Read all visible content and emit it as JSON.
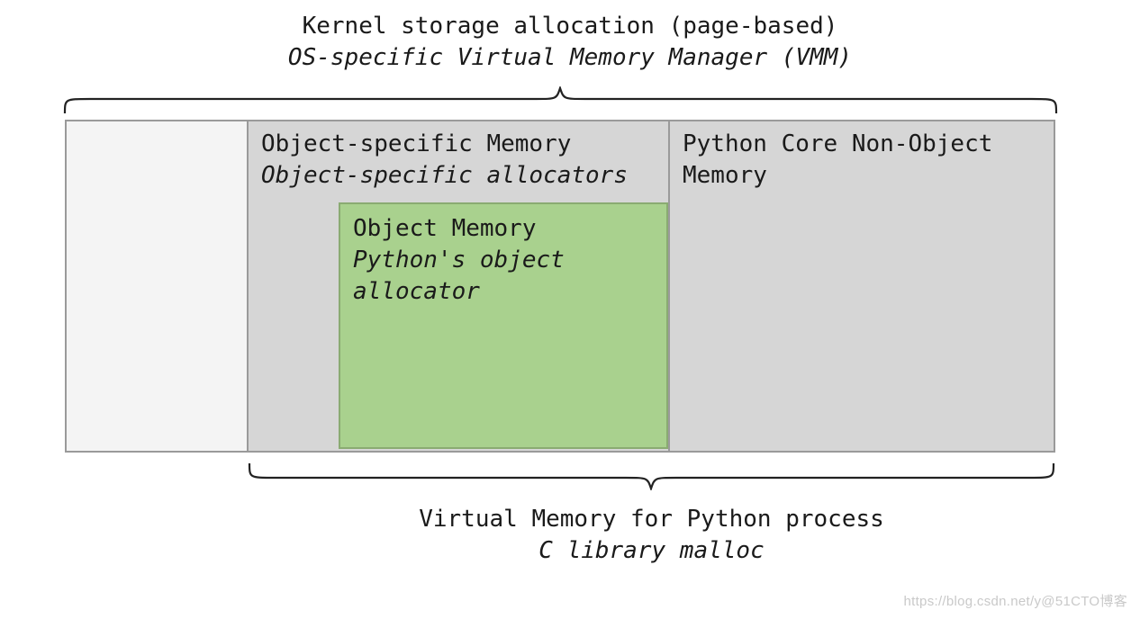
{
  "top": {
    "line1": "Kernel storage allocation (page-based)",
    "line2": "OS-specific Virtual Memory Manager (VMM)"
  },
  "mid": {
    "line1": "Object-specific Memory",
    "line2": "Object-specific allocators"
  },
  "green": {
    "line1": "Object Memory",
    "line2": "Python's object",
    "line3": "allocator"
  },
  "right": {
    "line1": "Python Core Non-Object",
    "line2": "Memory"
  },
  "bottom": {
    "line1": "Virtual Memory for Python process",
    "line2": "C library malloc"
  },
  "watermark": "https://blog.csdn.net/y@51CTO博客"
}
